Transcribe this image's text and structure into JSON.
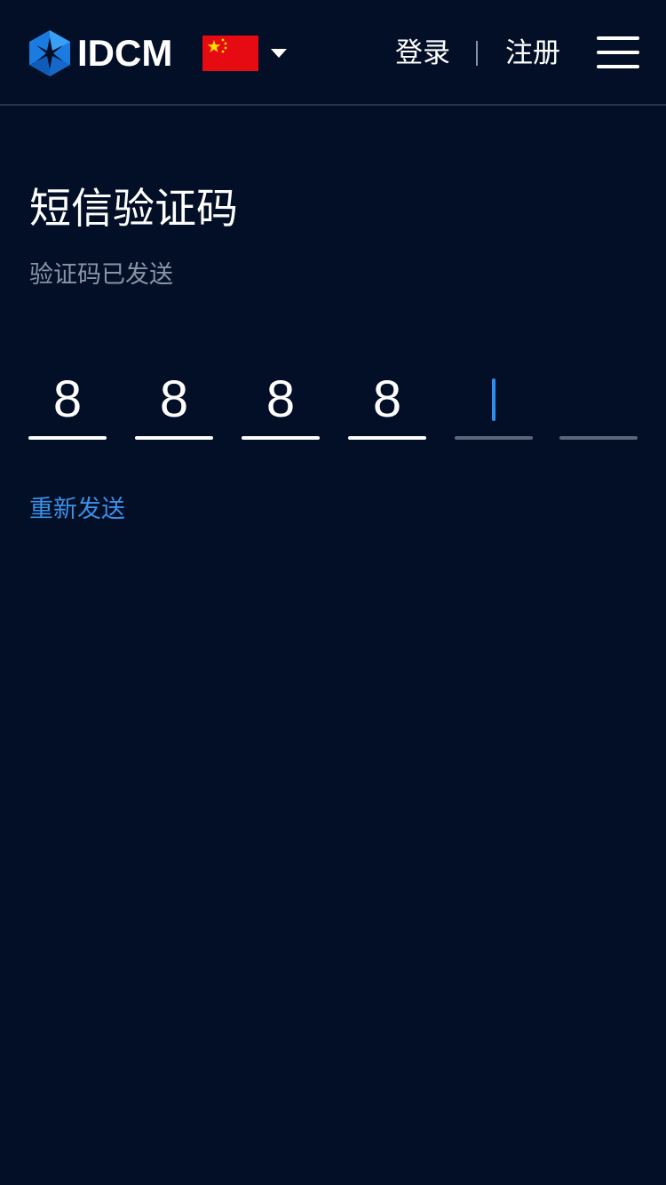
{
  "header": {
    "logo_text": "IDCM",
    "language_flag": "china-flag-icon",
    "login_label": "登录",
    "register_label": "注册",
    "menu_icon": "hamburger-menu-icon"
  },
  "main": {
    "title": "短信验证码",
    "subtitle": "验证码已发送",
    "code_digits": [
      "8",
      "8",
      "8",
      "8",
      "",
      ""
    ],
    "resend_label": "重新发送"
  },
  "colors": {
    "background": "#020f26",
    "accent": "#3d8fe6",
    "flag_red": "#e60a12",
    "flag_yellow": "#ffde00",
    "muted_text": "#8a94a6"
  }
}
